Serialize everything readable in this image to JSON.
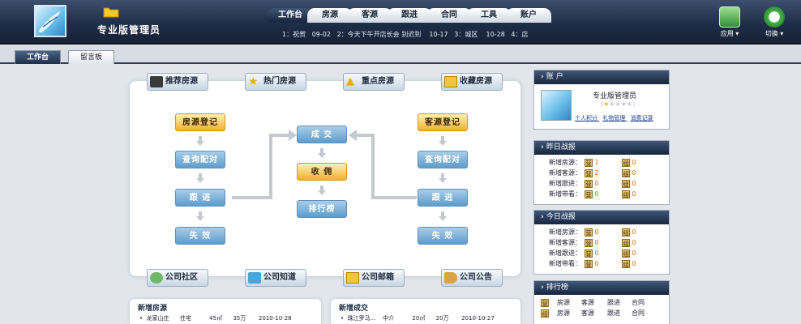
{
  "header": {
    "user_name": "专业版管理员",
    "tabs": [
      "工作台",
      "房源",
      "客源",
      "跟进",
      "合同",
      "工具",
      "账户"
    ],
    "active_tab": "工作台",
    "ticker": "1：祝贺   09-02   2：今天下午开店长会 别迟到    10-17   3：城区    10-28   4：店",
    "tools": [
      {
        "label": "应用",
        "icon": "apps-icon"
      },
      {
        "label": "切换",
        "icon": "switch-icon"
      }
    ]
  },
  "nav_tabs": [
    "工作台",
    "留言板"
  ],
  "flow": {
    "top_links": [
      "推荐房源",
      "热门房源",
      "重点房源",
      "收藏房源"
    ],
    "bottom_links": [
      "公司社区",
      "公司知道",
      "公司邮箱",
      "公司公告"
    ],
    "left_steps": [
      "房源登记",
      "查询配对",
      "跟 进",
      "失 效"
    ],
    "right_steps": [
      "客源登记",
      "查询配对",
      "跟 进",
      "失 效"
    ],
    "center_steps": [
      "成 交",
      "收 佣",
      "排行榜"
    ]
  },
  "account": {
    "title": "账 户",
    "name": "专业版管理员",
    "links": [
      "个人积分",
      "礼物管理",
      "消费记录"
    ]
  },
  "yesterday": {
    "title": "昨日战报",
    "rows": [
      {
        "label": "新增房源：",
        "a": "1",
        "b": "0"
      },
      {
        "label": "新增客源：",
        "a": "2",
        "b": "0"
      },
      {
        "label": "新增跟进：",
        "a": "0",
        "b": "0"
      },
      {
        "label": "新增带看：",
        "a": "0",
        "b": "0"
      }
    ],
    "badge_a": "营",
    "badge_b": "组"
  },
  "today": {
    "title": "今日战报",
    "rows": [
      {
        "label": "新增房源：",
        "a": "0",
        "b": "0"
      },
      {
        "label": "新增客源：",
        "a": "0",
        "b": "0"
      },
      {
        "label": "新增跟进：",
        "a": "0",
        "b": "0"
      },
      {
        "label": "新增带看：",
        "a": "0",
        "b": "0"
      }
    ],
    "badge_a": "营",
    "badge_b": "组"
  },
  "ranking": {
    "title": "排行榜",
    "rows": [
      {
        "badge": "营",
        "cols": [
          "房源",
          "客源",
          "跟进",
          "合同"
        ]
      },
      {
        "badge": "组",
        "cols": [
          "房源",
          "客源",
          "跟进",
          "合同"
        ]
      }
    ]
  },
  "new_listings": {
    "title": "新增房源",
    "row": "•  龙家山庄      住宅          45㎡      35万       2010-10-28"
  },
  "new_deals": {
    "title": "新增成交",
    "row": "•  珠江罗马...    中介          20㎡      20万       2010-10-27"
  }
}
